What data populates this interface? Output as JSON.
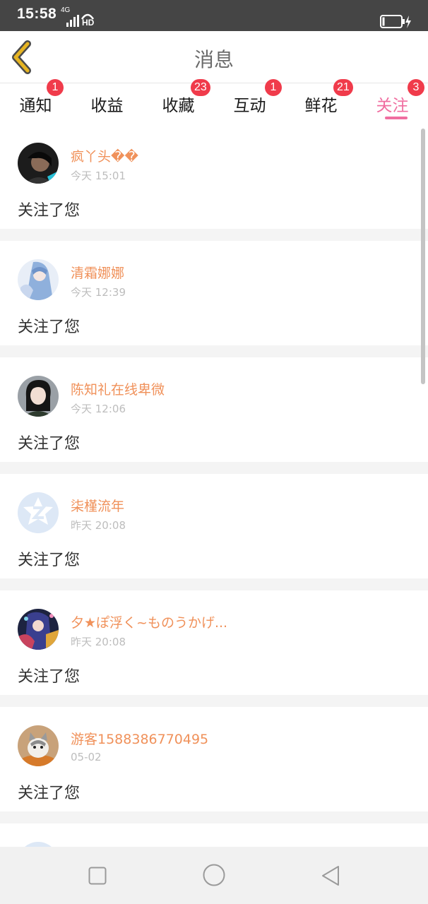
{
  "status_bar": {
    "time": "15:58",
    "network": "4G",
    "hd": "HD"
  },
  "header": {
    "title": "消息"
  },
  "tabs": [
    {
      "label": "通知",
      "badge": "1"
    },
    {
      "label": "收益",
      "badge": ""
    },
    {
      "label": "收藏",
      "badge": "23"
    },
    {
      "label": "互动",
      "badge": "1"
    },
    {
      "label": "鲜花",
      "badge": "21"
    },
    {
      "label": "关注",
      "badge": "3",
      "active": true
    }
  ],
  "colors": {
    "accent": "#f06ea0",
    "username": "#f0915a",
    "badge": "#f03b4b",
    "back_arrow": "#e6b422"
  },
  "messages": [
    {
      "username": "疯丫头��",
      "time": "今天 15:01",
      "text": "关注了您",
      "avatar": "dark-portrait"
    },
    {
      "username": "清霜娜娜",
      "time": "今天 12:39",
      "text": "关注了您",
      "avatar": "anime-blue-hair"
    },
    {
      "username": "陈知礼在线卑微",
      "time": "今天 12:06",
      "text": "关注了您",
      "avatar": "girl-portrait"
    },
    {
      "username": "柒槿流年",
      "time": "昨天 20:08",
      "text": "关注了您",
      "avatar": "default-z-logo"
    },
    {
      "username": "夕★ぽ浮く~ものうかげ...",
      "time": "昨天 20:08",
      "text": "关注了您",
      "avatar": "anime-colorful"
    },
    {
      "username": "游客1588386770495",
      "time": "05-02",
      "text": "关注了您",
      "avatar": "kitten"
    }
  ]
}
